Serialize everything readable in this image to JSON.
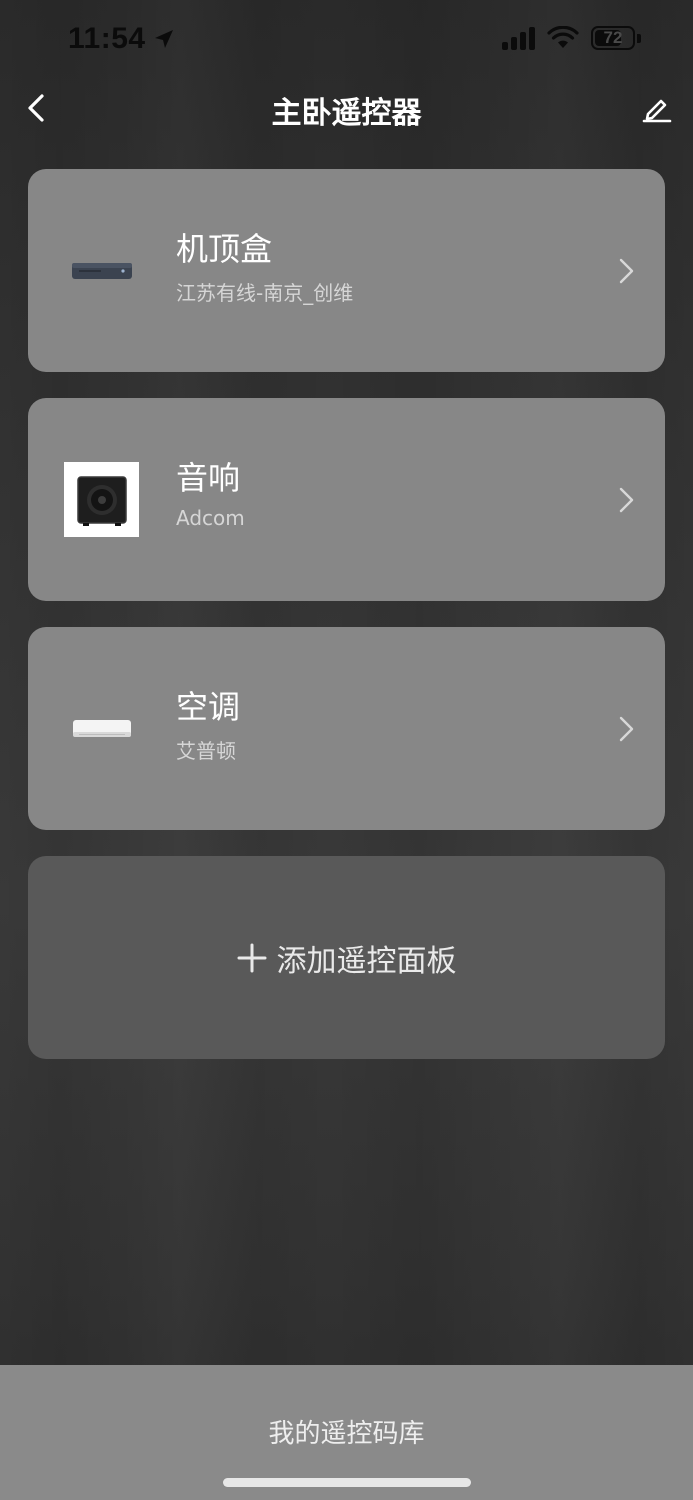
{
  "status_bar": {
    "time": "11:54",
    "battery_level": "72",
    "battery_fraction": 0.72
  },
  "nav": {
    "title": "主卧遥控器",
    "back_icon": "chevron-left-icon",
    "edit_icon": "pencil-icon"
  },
  "devices": [
    {
      "title": "机顶盒",
      "subtitle": "江苏有线-南京_创维",
      "icon": "set-top-box-icon"
    },
    {
      "title": "音响",
      "subtitle": "Adcom",
      "icon": "speaker-icon"
    },
    {
      "title": "空调",
      "subtitle": "艾普顿",
      "icon": "air-conditioner-icon"
    }
  ],
  "add_panel": {
    "label": "添加遥控面板",
    "icon": "plus-icon"
  },
  "bottom": {
    "label": "我的遥控码库"
  },
  "colors": {
    "card": "#878787",
    "add_card": "#595959",
    "bottom_bar": "#8a8a8a"
  }
}
